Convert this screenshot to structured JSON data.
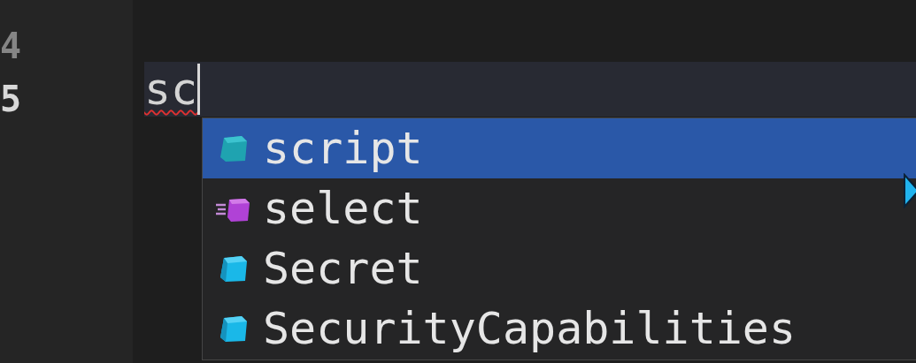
{
  "gutter": {
    "line_numbers": [
      "4",
      "5"
    ]
  },
  "editor": {
    "typed_text": "sc",
    "misspelled": true
  },
  "suggestions": [
    {
      "label": "script",
      "kind": "keyword",
      "selected": true
    },
    {
      "label": "select",
      "kind": "method",
      "selected": false
    },
    {
      "label": "Secret",
      "kind": "class",
      "selected": false
    },
    {
      "label": "SecurityCapabilities",
      "kind": "class",
      "selected": false
    }
  ]
}
